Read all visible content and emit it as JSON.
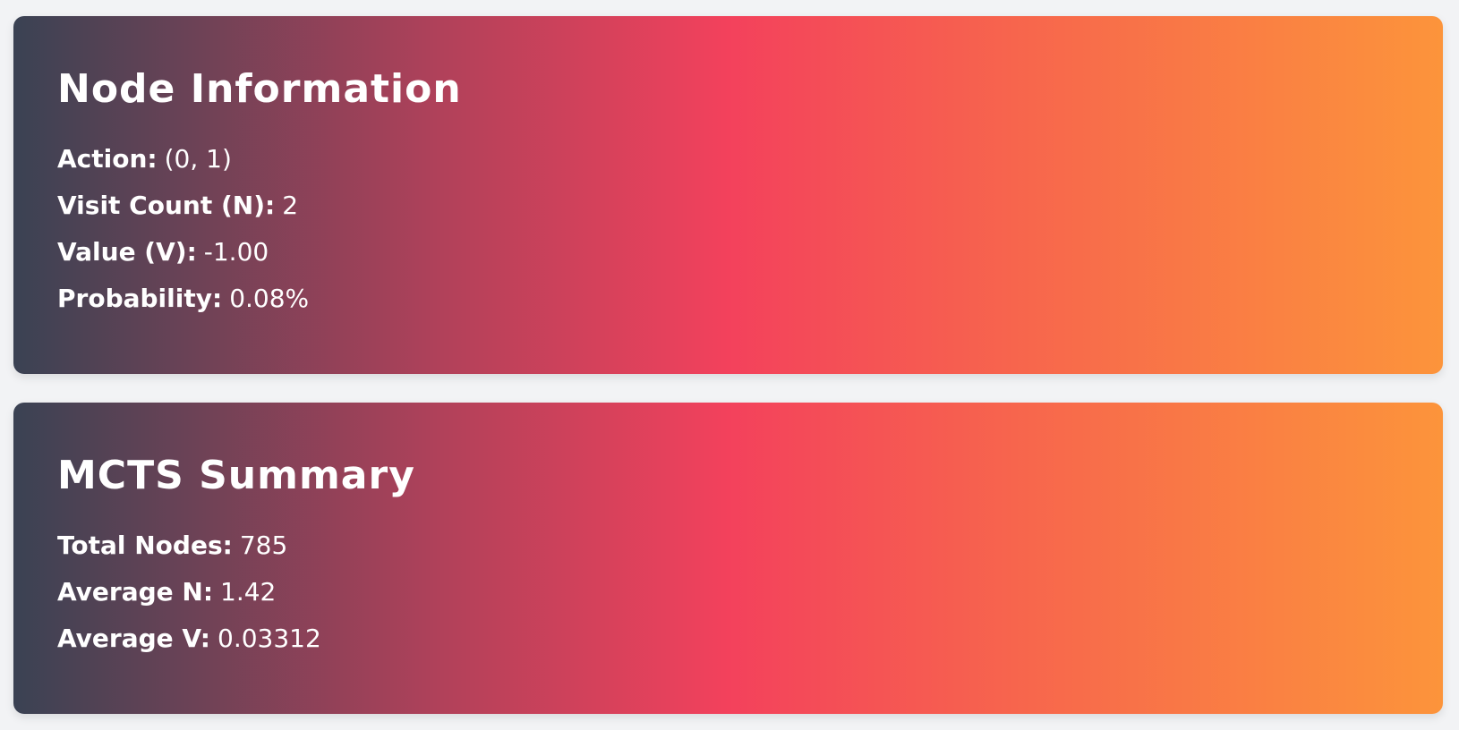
{
  "node_information": {
    "title": "Node Information",
    "rows": [
      {
        "label": "Action:",
        "value": "(0, 1)"
      },
      {
        "label": "Visit Count (N):",
        "value": "2"
      },
      {
        "label": "Value (V):",
        "value": "-1.00"
      },
      {
        "label": "Probability:",
        "value": "0.08%"
      }
    ]
  },
  "mcts_summary": {
    "title": "MCTS Summary",
    "rows": [
      {
        "label": "Total Nodes:",
        "value": "785"
      },
      {
        "label": "Average N:",
        "value": "1.42"
      },
      {
        "label": "Average V:",
        "value": "0.03312"
      }
    ]
  },
  "colors": {
    "page_background": "#f2f3f5",
    "gradient_start": "#3a4253",
    "gradient_mid": "#f3415c",
    "gradient_end": "#fc943b",
    "text": "#ffffff"
  }
}
